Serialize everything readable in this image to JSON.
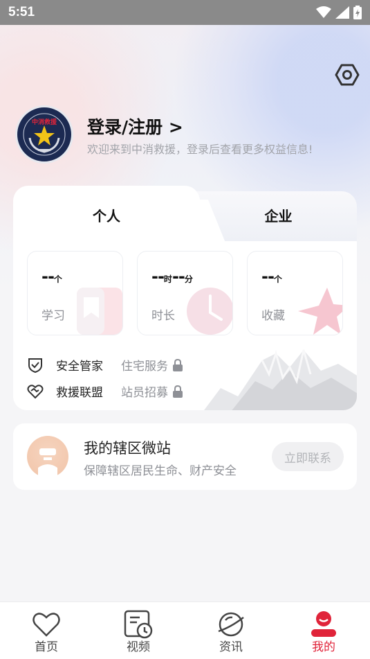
{
  "status_bar": {
    "time": "5:51"
  },
  "header": {
    "avatar_text": "中消救援",
    "login_title": "登录/注册 >",
    "login_subtitle": "欢迎来到中消救援，登录后查看更多权益信息!"
  },
  "tabs": [
    {
      "label": "个人",
      "active": true
    },
    {
      "label": "企业",
      "active": false
    }
  ],
  "stats": [
    {
      "value": "--",
      "unit": "个",
      "label": "学习",
      "icon": "bookmark-icon"
    },
    {
      "value": "--",
      "unit_h": "时",
      "value2": "--",
      "unit_m": "分",
      "label": "时长",
      "icon": "clock-icon"
    },
    {
      "value": "--",
      "unit": "个",
      "label": "收藏",
      "icon": "star-icon"
    }
  ],
  "features": [
    {
      "label": "安全管家",
      "locked_label": "住宅服务",
      "icon": "shield-check-icon"
    },
    {
      "label": "救援联盟",
      "locked_label": "站员招募",
      "icon": "heart-handshake-icon"
    }
  ],
  "station": {
    "title": "我的辖区微站",
    "subtitle": "保障辖区居民生命、财产安全",
    "button": "立即联系"
  },
  "nav": [
    {
      "label": "首页",
      "icon": "heart-icon",
      "active": false
    },
    {
      "label": "视频",
      "icon": "video-icon",
      "active": false
    },
    {
      "label": "资讯",
      "icon": "planet-icon",
      "active": false
    },
    {
      "label": "我的",
      "icon": "profile-icon",
      "active": true
    }
  ],
  "colors": {
    "accent": "#e0243a",
    "muted": "#8e9096",
    "background": "#f5f5f7"
  }
}
